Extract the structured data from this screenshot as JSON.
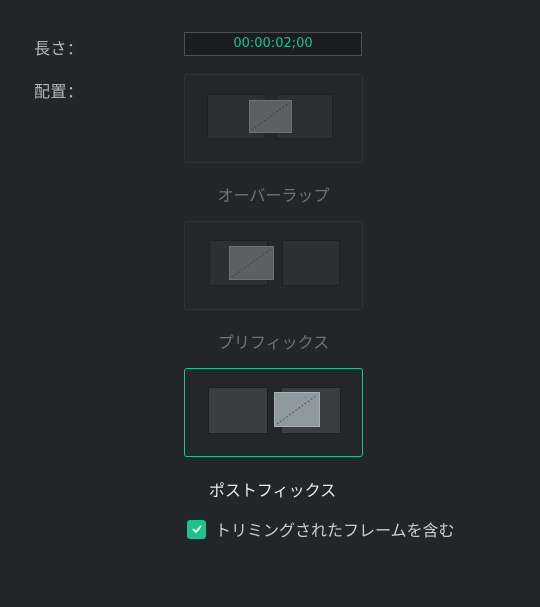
{
  "fields": {
    "length_label": "長さ：",
    "length_value": "00:00:02;00",
    "placement_label": "配置："
  },
  "placement": {
    "options": [
      {
        "label": "オーバーラップ",
        "selected": false
      },
      {
        "label": "プリフィックス",
        "selected": false
      },
      {
        "label": "ポストフィックス",
        "selected": true
      }
    ]
  },
  "include_trimmed": {
    "label": "トリミングされたフレームを含む",
    "checked": true
  },
  "colors": {
    "accent": "#1fc28a",
    "background": "#22252a",
    "text_dim": "#6f7378",
    "text_active": "#e8eaec"
  },
  "icons": {
    "checkbox": "checkmark-icon"
  }
}
